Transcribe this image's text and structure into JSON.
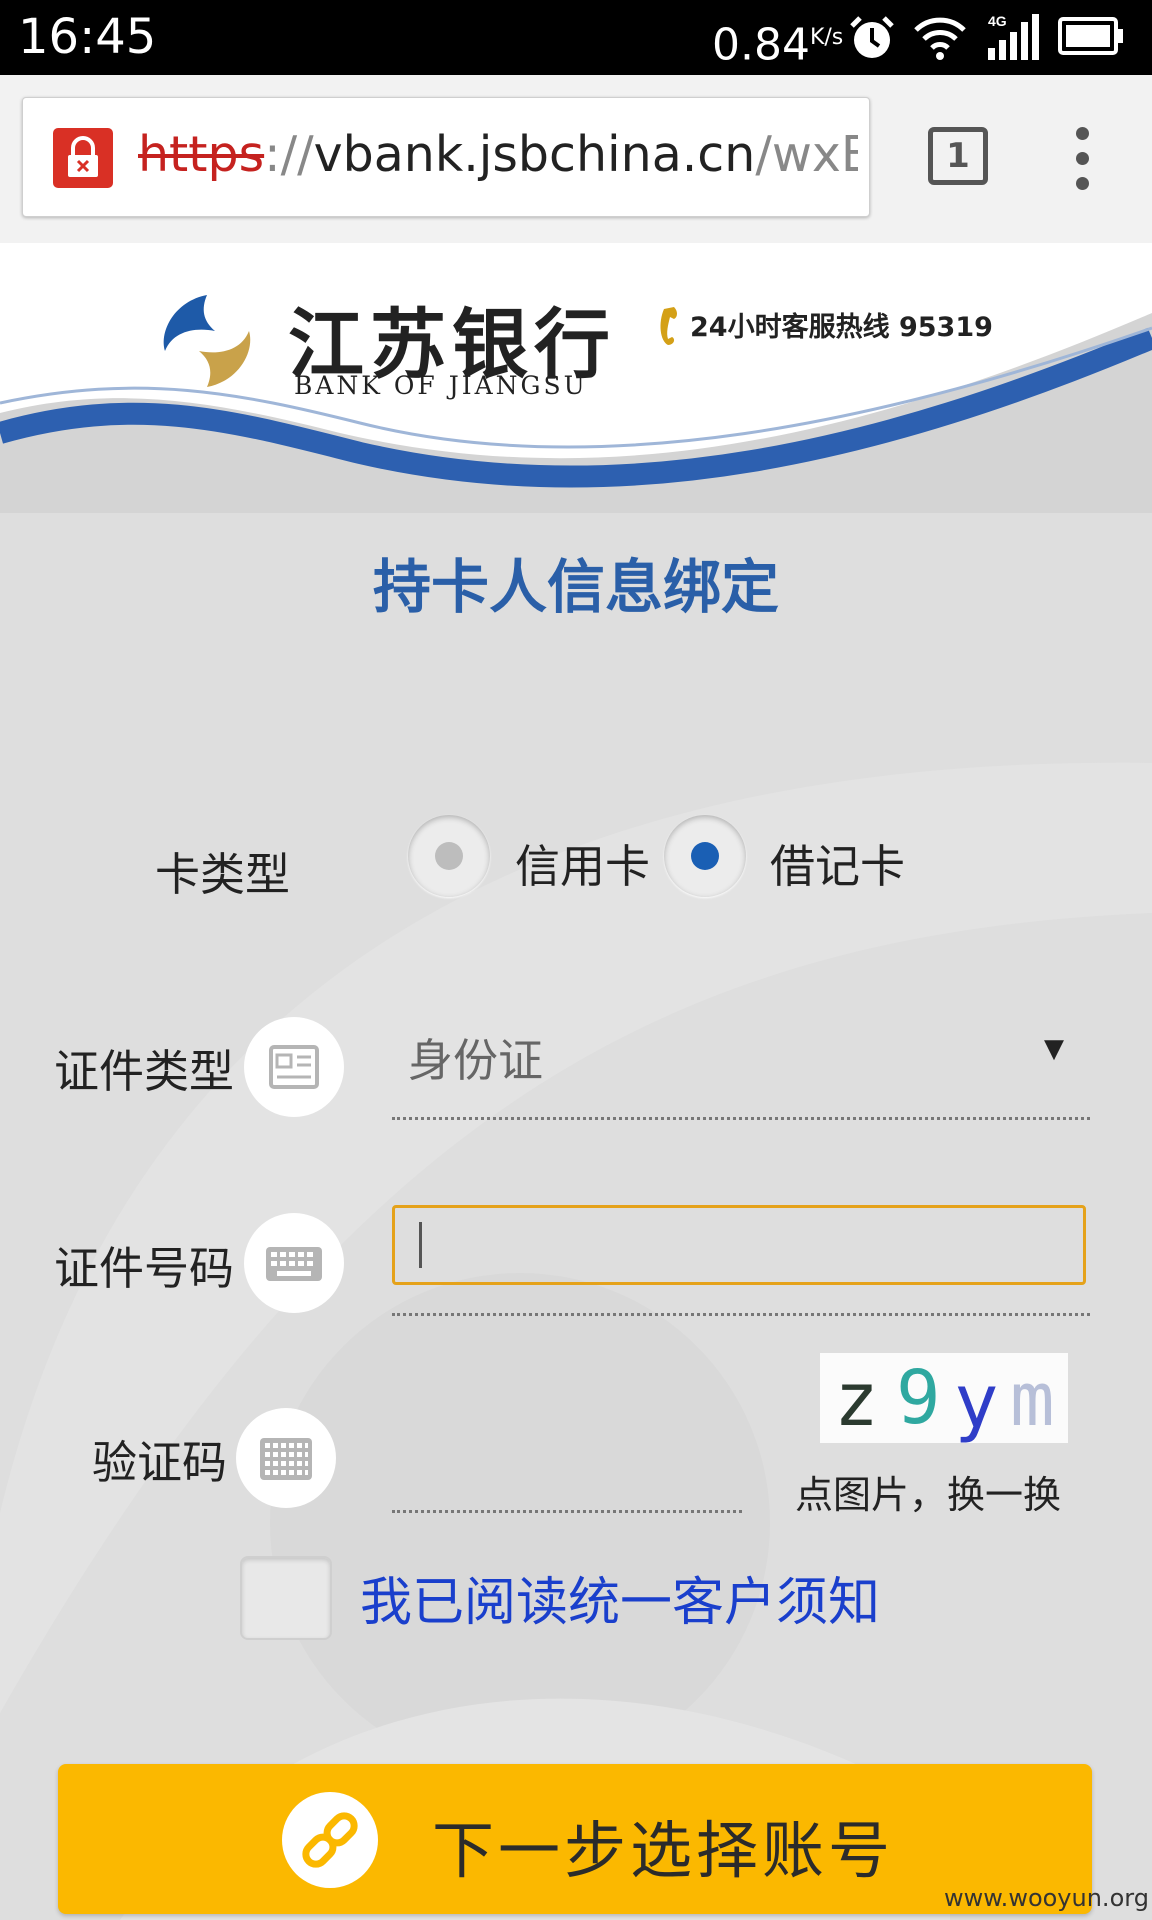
{
  "status_bar": {
    "time": "16:45",
    "network_speed": "0.84",
    "speed_unit": "K/s",
    "icons": [
      "alarm-icon",
      "wifi-icon",
      "4g-signal-icon",
      "battery-icon"
    ],
    "network_type": "4G"
  },
  "browser": {
    "url_scheme": "https",
    "url_separator": "://",
    "url_host": "vbank.jsbchina.cn",
    "url_path": "/wxBank",
    "tab_count": "1",
    "icons": [
      "insecure-lock-icon",
      "tabs-icon",
      "overflow-menu-icon"
    ]
  },
  "header": {
    "bank_name_cn": "江苏银行",
    "bank_name_en": "BANK OF JIANGSU",
    "hotline_text": "24小时客服热线  95319",
    "colors": {
      "logo_blue": "#1e5aa8",
      "logo_gold": "#c9a24a",
      "wave_blue": "#2d60b0"
    }
  },
  "page": {
    "title": "持卡人信息绑定",
    "card_type": {
      "label": "卡类型",
      "options": [
        {
          "label": "信用卡",
          "selected": false
        },
        {
          "label": "借记卡",
          "selected": true
        }
      ]
    },
    "id_type": {
      "label": "证件类型",
      "value": "身份证",
      "dropdown_arrow": "▼",
      "icon": "id-card-icon"
    },
    "id_number": {
      "label": "证件号码",
      "value": "",
      "icon": "keyboard-icon"
    },
    "captcha": {
      "label": "验证码",
      "value": "",
      "icon": "keypad-icon",
      "image_text": [
        "z",
        "9",
        "y",
        "m"
      ],
      "refresh_hint": "点图片，换一换"
    },
    "agreement": {
      "checked": false,
      "text": "我已阅读统一客户须知"
    },
    "next_button": {
      "label": "下一步选择账号",
      "icon": "link-icon",
      "color": "#fbb800"
    }
  },
  "watermark": "www.wooyun.org"
}
